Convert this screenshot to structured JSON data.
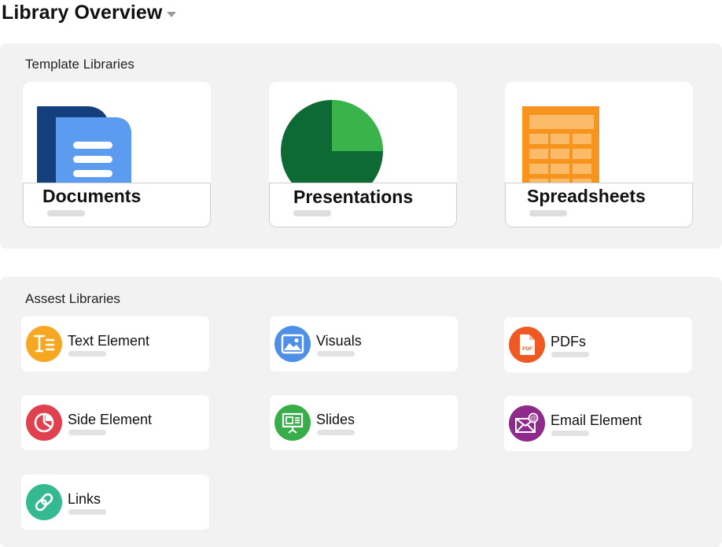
{
  "header": {
    "title": "Library Overview",
    "dropdown_icon": "caret-down-icon"
  },
  "template_section": {
    "heading": "Template Libraries",
    "cards": [
      {
        "name": "Documents",
        "icon": "document-icon",
        "color": "#4f8ff0"
      },
      {
        "name": "Presentations",
        "icon": "pie-chart-icon",
        "color": "#3db34a"
      },
      {
        "name": "Spreadsheets",
        "icon": "spreadsheet-icon",
        "color": "#f7941d"
      }
    ]
  },
  "asset_section": {
    "heading": "Assest Libraries",
    "cards": [
      {
        "name": "Text Element",
        "icon": "text-format-icon",
        "color": "#f7a823"
      },
      {
        "name": "Visuals",
        "icon": "image-icon",
        "color": "#4f8fe8"
      },
      {
        "name": "PDFs",
        "icon": "pdf-file-icon",
        "color": "#ef5a24",
        "icon_text": "PDF"
      },
      {
        "name": "Side Element",
        "icon": "pie-chart-icon",
        "color": "#e0414e"
      },
      {
        "name": "Slides",
        "icon": "presentation-board-icon",
        "color": "#3aad4b"
      },
      {
        "name": "Email Element",
        "icon": "envelope-icon",
        "color": "#8e2a8c"
      },
      {
        "name": "Links",
        "icon": "link-icon",
        "color": "#34b991"
      }
    ]
  }
}
